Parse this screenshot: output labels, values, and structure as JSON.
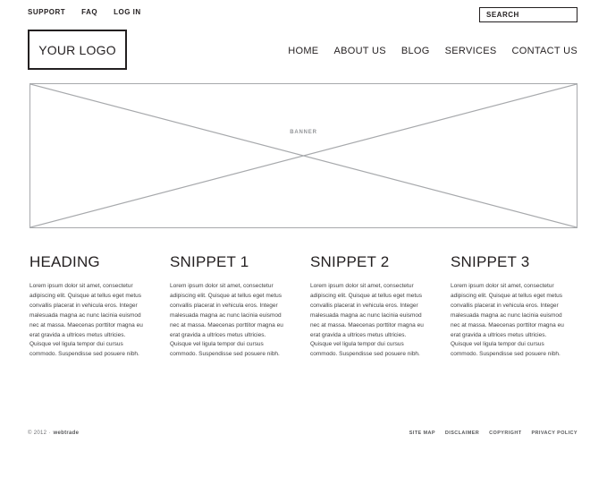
{
  "utility_nav": {
    "items": [
      {
        "label": "SUPPORT",
        "name": "utility-link-support"
      },
      {
        "label": "FAQ",
        "name": "utility-link-faq"
      },
      {
        "label": "LOG IN",
        "name": "utility-link-login"
      }
    ]
  },
  "search": {
    "placeholder": "SEARCH",
    "value": ""
  },
  "logo": {
    "text": "YOUR LOGO"
  },
  "main_nav": {
    "items": [
      {
        "label": "HOME"
      },
      {
        "label": "ABOUT US"
      },
      {
        "label": "BLOG"
      },
      {
        "label": "SERVICES"
      },
      {
        "label": "CONTACT US"
      }
    ]
  },
  "banner": {
    "label": "BANNER"
  },
  "columns": [
    {
      "title": "HEADING",
      "body": "Lorem ipsum dolor sit amet, consectetur adipiscing elit. Quisque at tellus eget metus convallis placerat in vehicula eros. Integer malesuada magna ac nunc lacinia euismod nec at massa. Maecenas porttitor magna eu erat gravida a ultrices metus ultricies. Quisque vel ligula tempor dui cursus commodo. Suspendisse sed posuere nibh."
    },
    {
      "title": "SNIPPET 1",
      "body": "Lorem ipsum dolor sit amet, consectetur adipiscing elit. Quisque at tellus eget metus convallis placerat in vehicula eros. Integer malesuada magna ac nunc lacinia euismod nec at massa. Maecenas porttitor magna eu erat gravida a ultrices metus ultricies. Quisque vel ligula tempor dui cursus commodo. Suspendisse sed posuere nibh."
    },
    {
      "title": "SNIPPET 2",
      "body": "Lorem ipsum dolor sit amet, consectetur adipiscing elit. Quisque at tellus eget metus convallis placerat in vehicula eros. Integer malesuada magna ac nunc lacinia euismod nec at massa. Maecenas porttitor magna eu erat gravida a ultrices metus ultricies. Quisque vel ligula tempor dui cursus commodo. Suspendisse sed posuere nibh."
    },
    {
      "title": "SNIPPET 3",
      "body": "Lorem ipsum dolor sit amet, consectetur adipiscing elit. Quisque at tellus eget metus convallis placerat in vehicula eros. Integer malesuada magna ac nunc lacinia euismod nec at massa. Maecenas porttitor magna eu erat gravida a ultrices metus ultricies. Quisque vel ligula tempor dui cursus commodo. Suspendisse sed posuere nibh."
    }
  ],
  "footer": {
    "copyright_prefix": "© 2012 ·",
    "brand": "webtrade",
    "links": [
      {
        "label": "SITE MAP"
      },
      {
        "label": "DISCLAIMER"
      },
      {
        "label": "COPYRIGHT"
      },
      {
        "label": "PRIVACY POLICY"
      }
    ]
  },
  "colors": {
    "ink": "#231f20",
    "body_text": "#414042",
    "placeholder_line": "#a7a9ac",
    "muted": "#58595b"
  }
}
